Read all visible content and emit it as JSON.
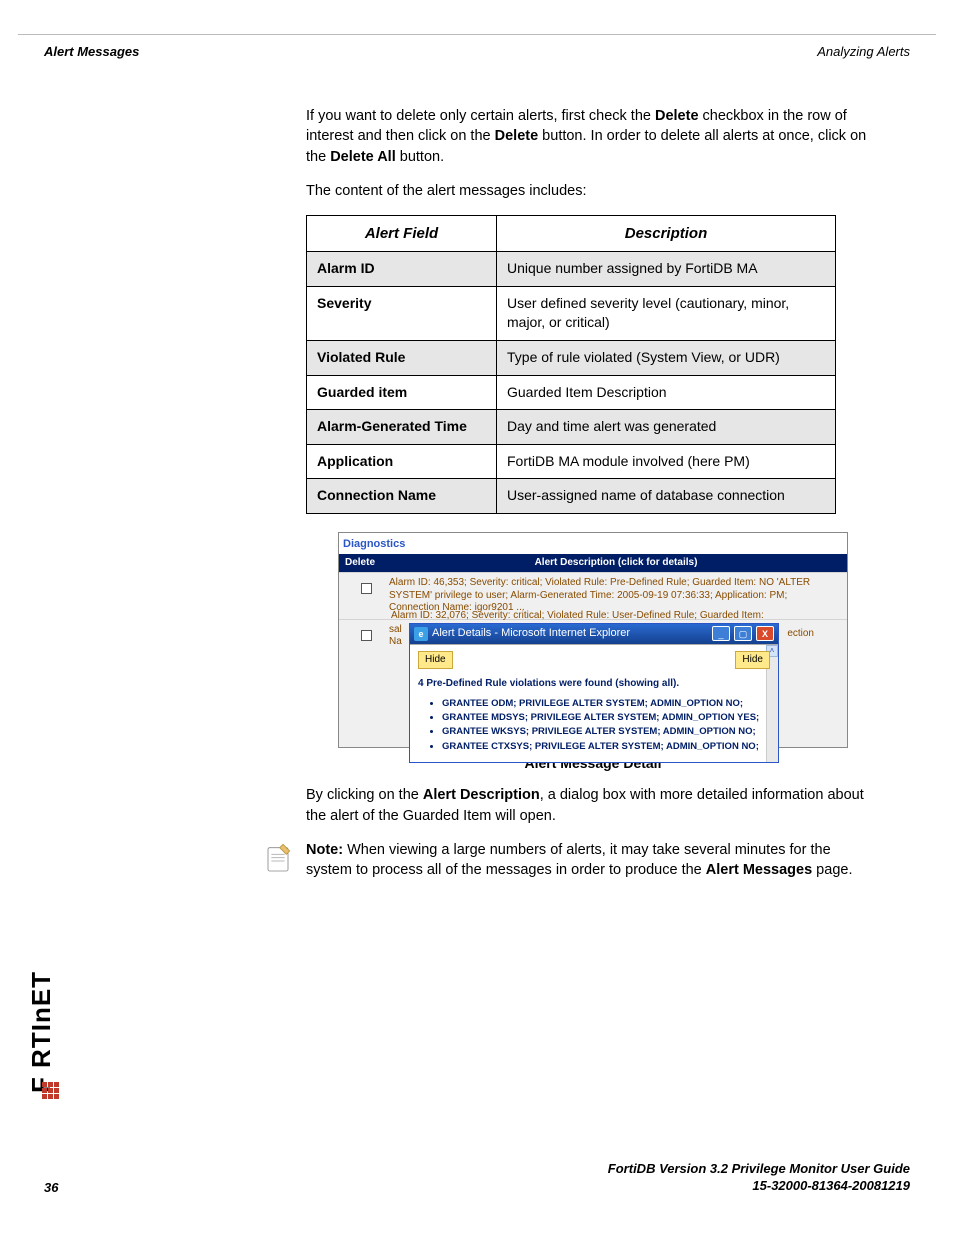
{
  "header": {
    "left": "Alert Messages",
    "right": "Analyzing Alerts"
  },
  "intro": {
    "p1_a": "If you want to delete only certain alerts, first check the ",
    "p1_b": "Delete",
    "p1_c": " checkbox in the row of interest and then click on the ",
    "p1_d": "Delete",
    "p1_e": " button. In order to delete all alerts at once, click on the ",
    "p1_f": "Delete All",
    "p1_g": " button.",
    "p2": "The content of the alert messages includes:"
  },
  "table": {
    "h1": "Alert Field",
    "h2": "Description",
    "rows": [
      {
        "f": "Alarm ID",
        "d": "Unique number assigned by FortiDB MA"
      },
      {
        "f": "Severity",
        "d": "User defined severity level (cautionary, minor, major, or critical)"
      },
      {
        "f": "Violated Rule",
        "d": "Type of rule violated (System View, or UDR)"
      },
      {
        "f": "Guarded item",
        "d": "Guarded Item Description"
      },
      {
        "f": "Alarm-Generated Time",
        "d": "Day and time alert was generated"
      },
      {
        "f": "Application",
        "d": "FortiDB MA module involved (here PM)"
      },
      {
        "f": "Connection Name",
        "d": "User-assigned name of database connection"
      }
    ]
  },
  "figure": {
    "panel_title": "Diagnostics",
    "col_delete": "Delete",
    "col_desc": "Alert Description (click for details)",
    "row1": "Alarm ID: 46,353; Severity: critical; Violated Rule: Pre-Defined Rule; Guarded Item: NO 'ALTER SYSTEM' privilege to user; Alarm-Generated Time: 2005-09-19 07:36:33; Application: PM; Connection Name: igor9201 ...",
    "row2_cut": "Alarm ID: 32,076; Severity: critical; Violated Rule: User-Defined Rule; Guarded Item:",
    "row2_sal": "sal",
    "row2_na": "Na",
    "ection": "ection",
    "popup_title": "Alert Details - Microsoft Internet Explorer",
    "hide": "Hide",
    "pd_line": "4 Pre-Defined Rule violations were found (showing all).",
    "bullets": [
      "GRANTEE ODM; PRIVILEGE ALTER SYSTEM; ADMIN_OPTION NO;",
      "GRANTEE MDSYS; PRIVILEGE ALTER SYSTEM; ADMIN_OPTION YES;",
      "GRANTEE WKSYS; PRIVILEGE ALTER SYSTEM; ADMIN_OPTION NO;",
      "GRANTEE CTXSYS; PRIVILEGE ALTER SYSTEM; ADMIN_OPTION NO;"
    ],
    "caption": "Alert Message Detail"
  },
  "after": {
    "p3_a": "By clicking on the ",
    "p3_b": "Alert Description",
    "p3_c": ", a dialog box with more detailed information about the alert of the Guarded Item will open.",
    "note_lead": "Note:",
    "note_a": " When viewing a large numbers of alerts, it may take several minutes for the system to process all of the messages in order to produce the ",
    "note_b": "Alert Messages",
    "note_c": " page."
  },
  "footer": {
    "page": "36",
    "line1": "FortiDB Version 3.2 Privilege Monitor  User Guide",
    "line2": "15-32000-81364-20081219"
  }
}
